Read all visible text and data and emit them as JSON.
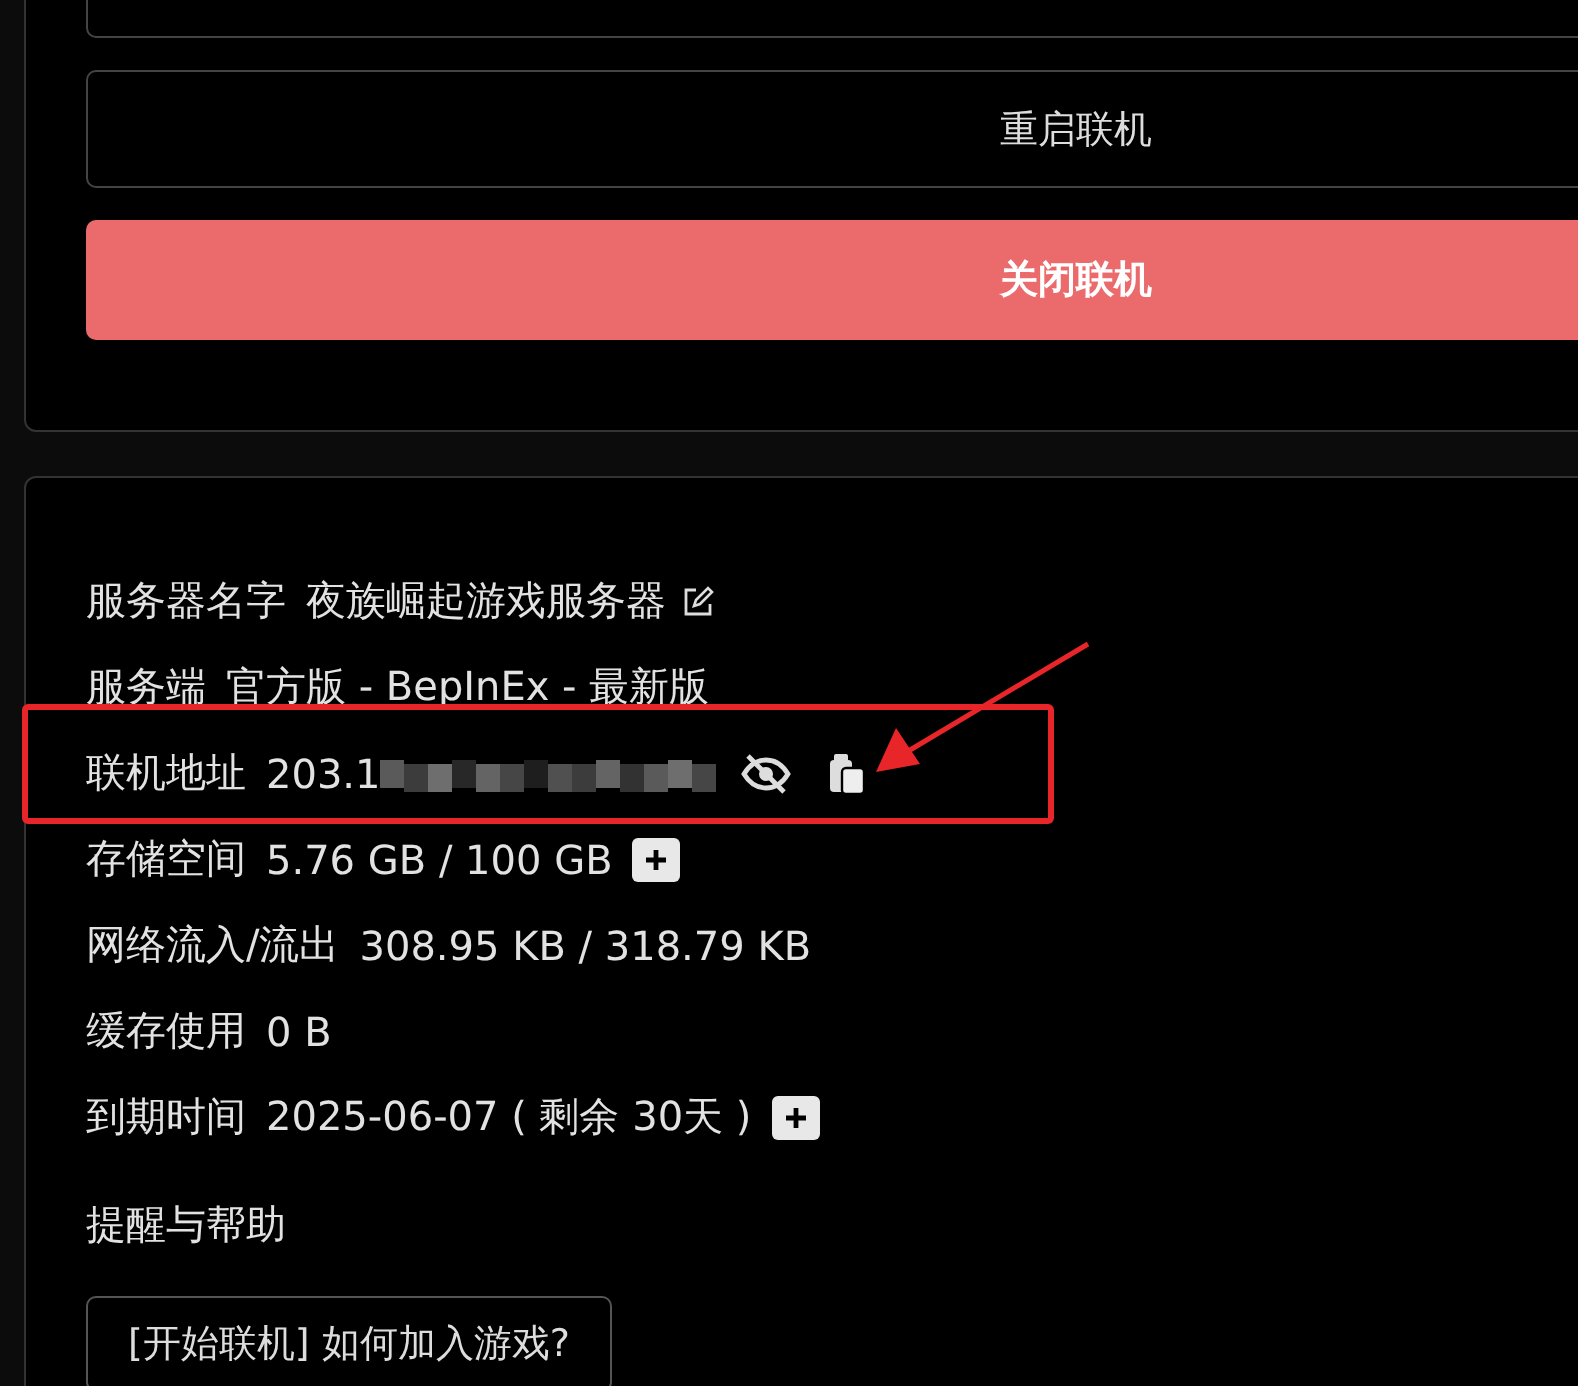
{
  "control_card": {
    "buttons": [
      {
        "label": "重启联机",
        "kind": "outline"
      },
      {
        "label": "关闭联机",
        "kind": "danger"
      }
    ]
  },
  "info_card": {
    "rows": [
      {
        "label": "服务器名字",
        "value": "夜族崛起游戏服务器",
        "kind": "editable"
      },
      {
        "label": "服务端",
        "value": "官方版 - BepInEx - 最新版",
        "kind": "plain"
      },
      {
        "label": "联机地址",
        "value": "203.1",
        "kind": "hidden_address"
      },
      {
        "label": "存储空间",
        "value": "5.76 GB / 100 GB",
        "kind": "expandable"
      },
      {
        "label": "网络流入/流出",
        "value": "308.95 KB / 318.79 KB",
        "kind": "plain"
      },
      {
        "label": "缓存使用",
        "value": "0 B",
        "kind": "plain"
      },
      {
        "label": "到期时间",
        "value": "2025-06-07 ( 剩余 30天 )",
        "kind": "expandable"
      }
    ],
    "help": {
      "title": "提醒与帮助",
      "buttons": [
        "[开始联机] 如何加入游戏?"
      ]
    }
  }
}
